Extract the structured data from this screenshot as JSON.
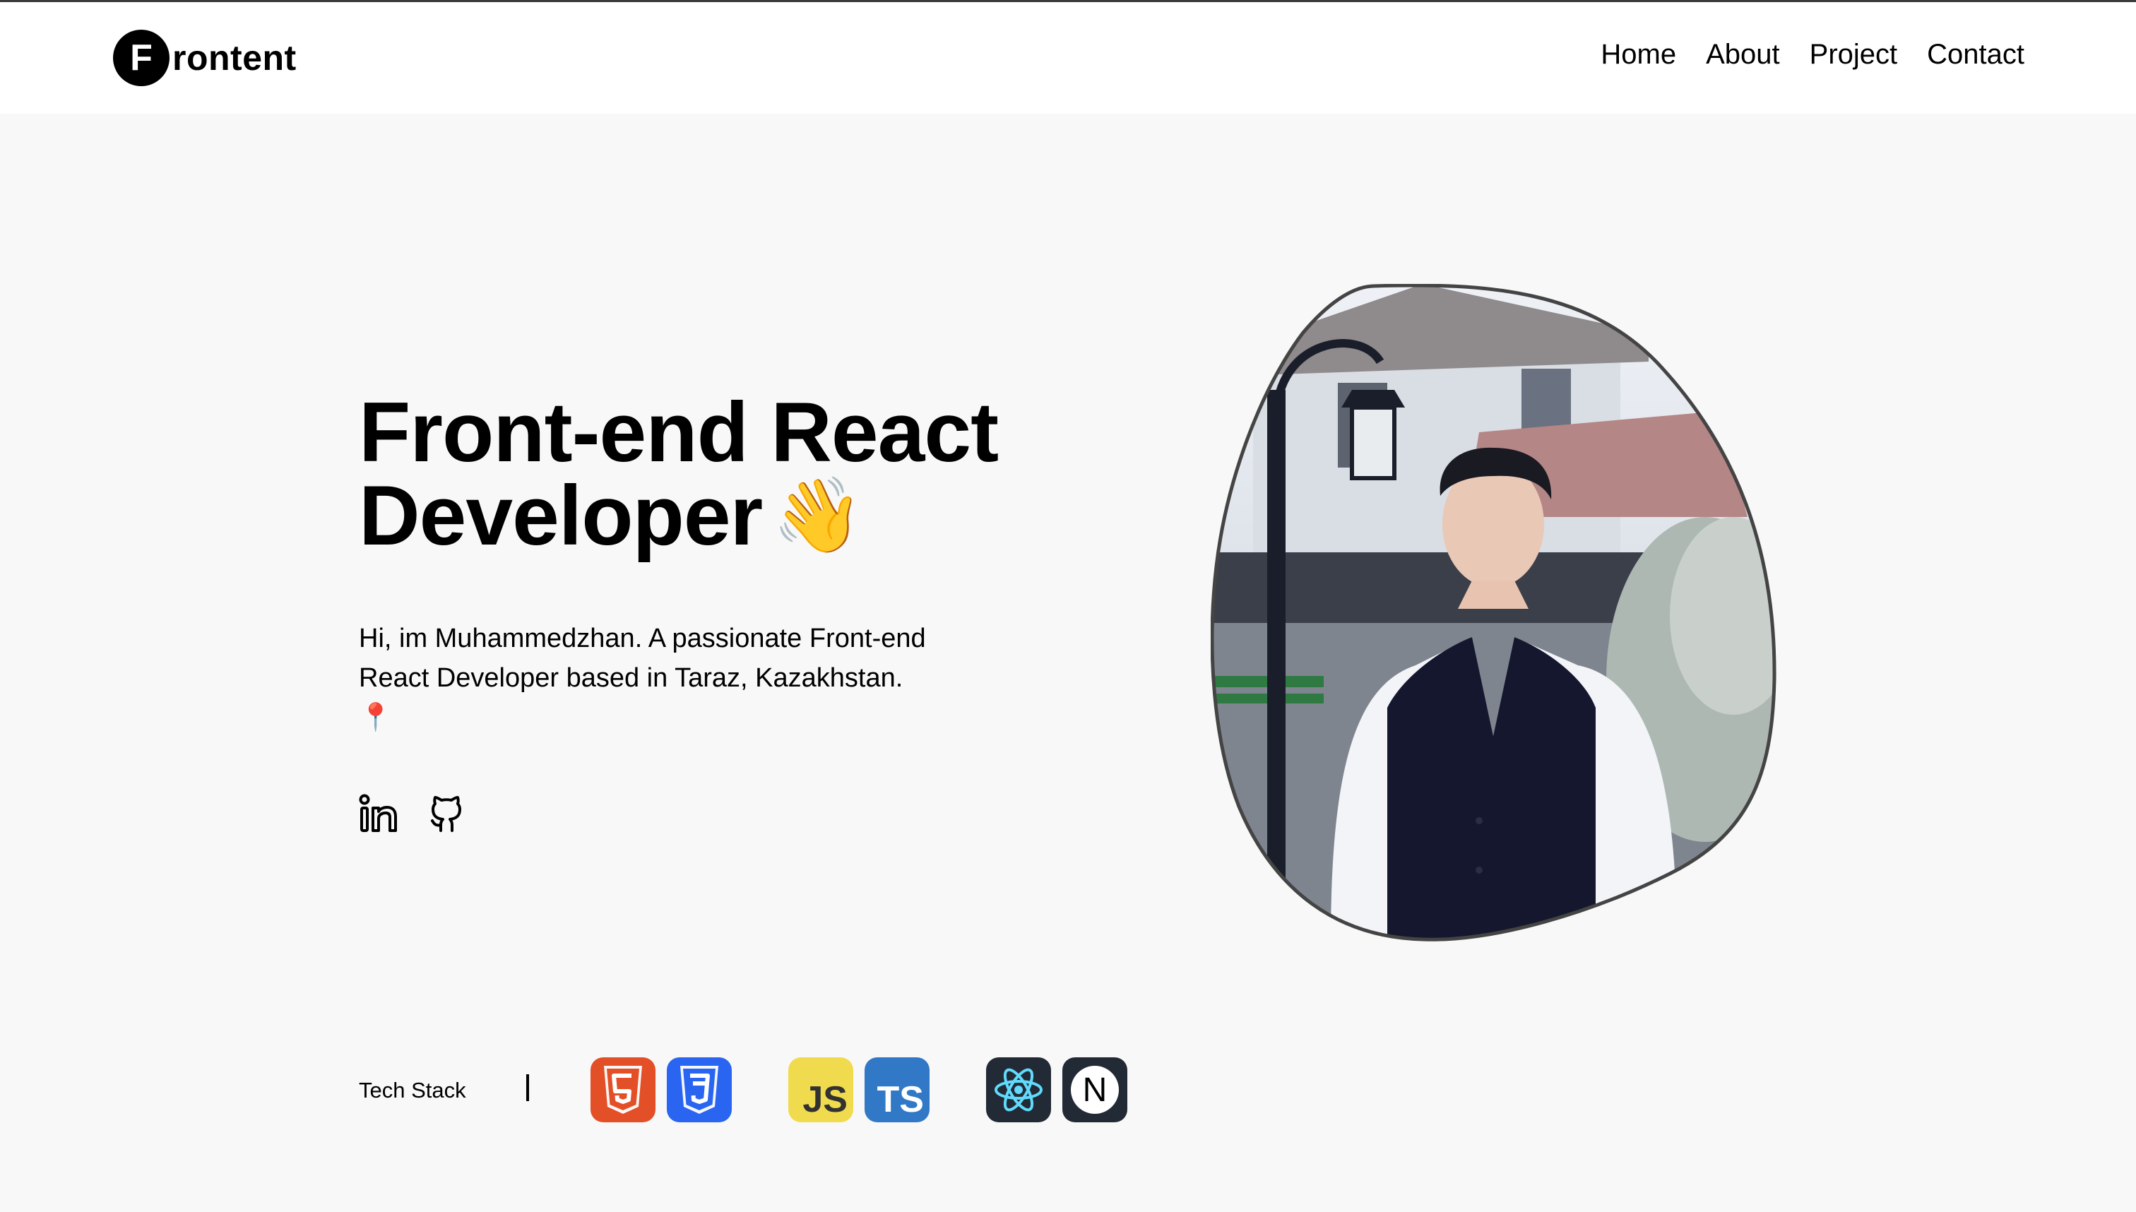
{
  "header": {
    "logo_letter": "F",
    "logo_rest": "rontent",
    "nav": [
      "Home",
      "About",
      "Project",
      "Contact"
    ]
  },
  "hero": {
    "title_line1": "Front-end React",
    "title_line2": "Developer",
    "wave_emoji": "👋",
    "intro": "Hi, im Muhammedzhan. A passionate Front-end React Developer based in Taraz, Kazakhstan.",
    "pin_emoji": "📍"
  },
  "socials": [
    {
      "icon": "linkedin-icon"
    },
    {
      "icon": "github-icon"
    }
  ],
  "tech_stack": {
    "label": "Tech Stack",
    "icons": [
      {
        "name": "html5-icon",
        "color": "#e34f26"
      },
      {
        "name": "css3-icon",
        "color": "#2965f1"
      },
      {
        "name": "javascript-icon",
        "color": "#f0db4f",
        "text": "JS"
      },
      {
        "name": "typescript-icon",
        "color": "#3178c6",
        "text": "TS"
      },
      {
        "name": "react-icon",
        "color": "#222a35"
      },
      {
        "name": "nextjs-icon",
        "color": "#222a35",
        "text": "N"
      }
    ]
  },
  "colors": {
    "background": "#f8f8f8",
    "header_bg": "#ffffff",
    "text": "#000000"
  }
}
